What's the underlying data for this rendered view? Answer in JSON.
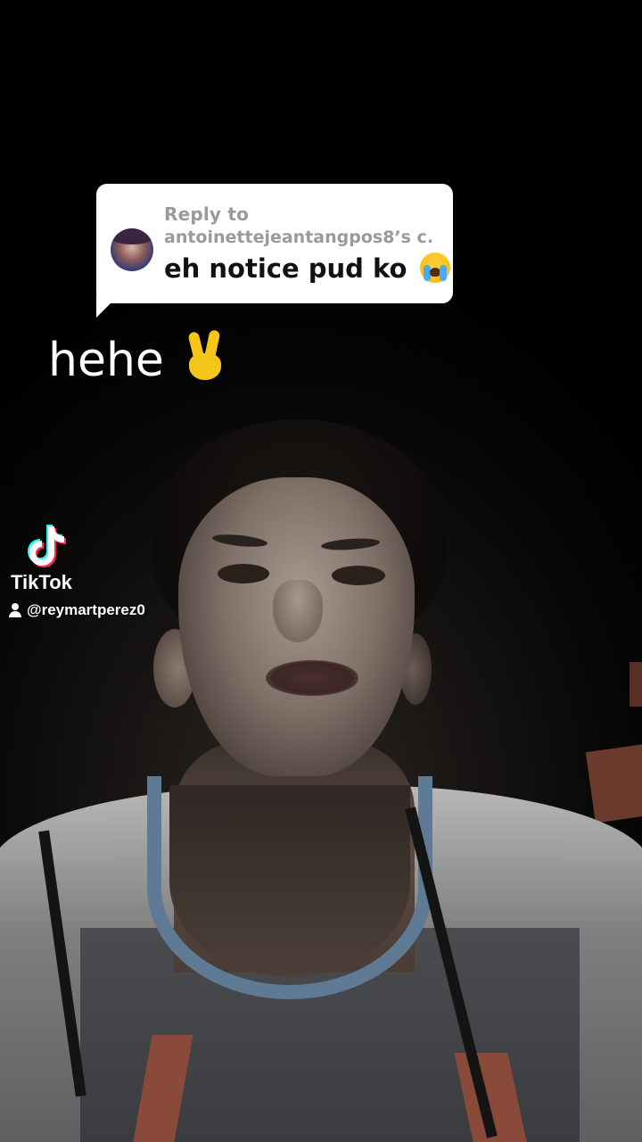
{
  "reply_bubble": {
    "label": "Reply to",
    "username": "antoinettejeantangpos8’s c...",
    "comment_text": "eh notice pud ko",
    "comment_emoji_icon": "loudly-crying-face-icon"
  },
  "caption": {
    "text": "hehe",
    "emoji_icon": "victory-hand-icon"
  },
  "watermark": {
    "brand": "TikTok",
    "username": "@reymartperez0",
    "logo_colors": {
      "cyan": "#25F4EE",
      "red": "#FE2C55",
      "white": "#FFFFFF"
    }
  }
}
